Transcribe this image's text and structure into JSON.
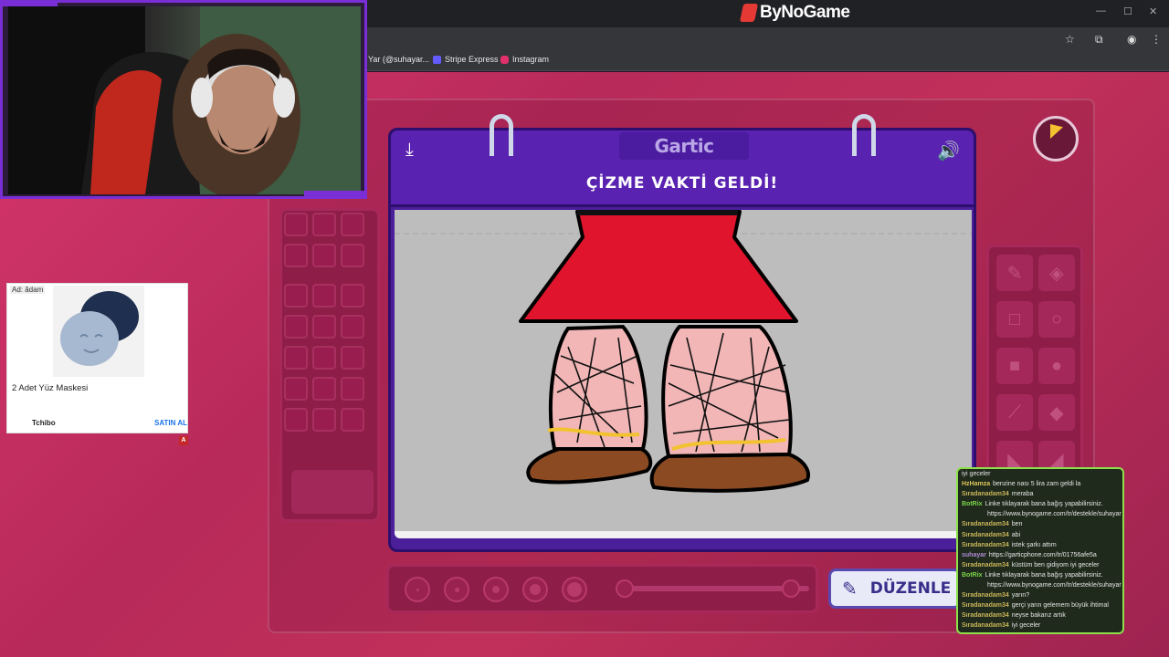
{
  "browser": {
    "site_logo": "ByNoGame",
    "bookmarks": [
      {
        "label": "Yar (@suhayar...",
        "color": "#35363a"
      },
      {
        "label": "Stripe Express",
        "color": "#635bff"
      },
      {
        "label": "Instagram",
        "color": "#e1306c"
      }
    ]
  },
  "game": {
    "logo": "Gartic",
    "title": "ÇİZME VAKTİ GELDİ!",
    "edit_button": "DÜZENLE",
    "timer_color": "#f2c230"
  },
  "ad": {
    "tag": "Ad: ădam",
    "product": "2 Adet Yüz Maskesi",
    "brand": "Tchibo",
    "cta": "SATIN AL",
    "badge": "A"
  },
  "chat": {
    "messages": [
      {
        "user": "",
        "text": "iyi geceler",
        "color": "#d6c27a"
      },
      {
        "user": "HzHamza",
        "text": "benzine nası 5 lira zam geldi la",
        "color": "#e0c75a"
      },
      {
        "user": "Sıradanadam34",
        "text": "meraba",
        "color": "#c9b55a"
      },
      {
        "user": "BotRix",
        "text": "Linke tıklayarak bana bağış yapabilirsiniz.",
        "color": "#7cd64a"
      },
      {
        "user": "",
        "text": "https://www.bynogame.com/tr/destekle/suhayar",
        "color": "#e6e6e6",
        "indent": true
      },
      {
        "user": "Sıradanadam34",
        "text": "ben",
        "color": "#c9b55a"
      },
      {
        "user": "Sıradanadam34",
        "text": "abi",
        "color": "#c9b55a"
      },
      {
        "user": "Sıradanadam34",
        "text": "istek şarkı attım",
        "color": "#c9b55a"
      },
      {
        "user": "suhayar",
        "text": "https://garticphone.com/tr/01756afe5a",
        "color": "#b08ad8"
      },
      {
        "user": "Sıradanadam34",
        "text": "küstüm ben gidiyom iyi geceler",
        "color": "#c9b55a"
      },
      {
        "user": "BotRix",
        "text": "Linke tıklayarak bana bağış yapabilirsiniz.",
        "color": "#7cd64a"
      },
      {
        "user": "",
        "text": "https://www.bynogame.com/tr/destekle/suhayar",
        "color": "#e6e6e6",
        "indent": true
      },
      {
        "user": "Sıradanadam34",
        "text": "yarın?",
        "color": "#c9b55a"
      },
      {
        "user": "Sıradanadam34",
        "text": "gerçi yarın gelemem büyük ihtimal",
        "color": "#c9b55a"
      },
      {
        "user": "Sıradanadam34",
        "text": "neyse bakarız artık",
        "color": "#c9b55a"
      },
      {
        "user": "Sıradanadam34",
        "text": "iyi geceler",
        "color": "#c9b55a"
      }
    ]
  }
}
